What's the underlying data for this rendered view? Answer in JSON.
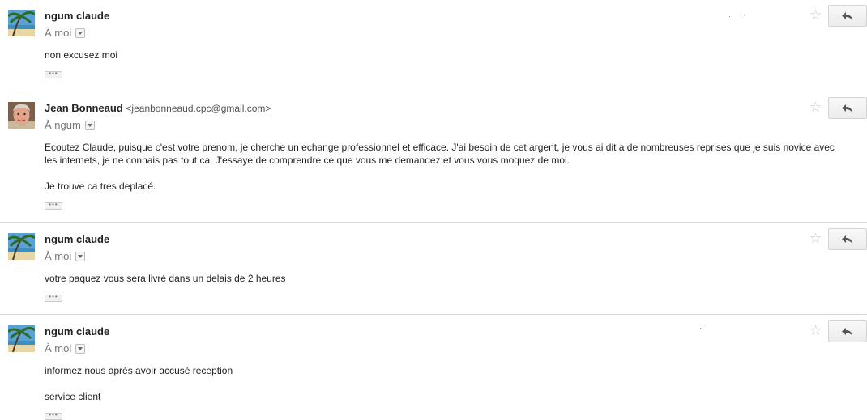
{
  "messages": [
    {
      "sender": "ngum claude",
      "sender_email": "",
      "recipient": "À moi",
      "paragraphs": [
        "non excusez moi"
      ],
      "avatar": "beach-palm-avatar"
    },
    {
      "sender": "Jean Bonneaud",
      "sender_email": "<jeanbonneaud.cpc@gmail.com>",
      "recipient": "À ngum",
      "paragraphs": [
        "Ecoutez Claude, puisque c'est votre prenom, je cherche un echange professionnel et efficace. J'ai besoin de cet argent, je vous ai dit a de nombreuses reprises que je suis novice avec les internets, je ne connais pas tout ca. J'essaye de comprendre ce que vous me demandez et vous vous moquez de moi.",
        "Je trouve ca tres deplacé."
      ],
      "avatar": "person-photo-avatar"
    },
    {
      "sender": "ngum claude",
      "sender_email": "",
      "recipient": "À moi",
      "paragraphs": [
        "votre paquez vous sera livré dans un delais de 2 heures"
      ],
      "avatar": "beach-palm-avatar"
    },
    {
      "sender": "ngum claude",
      "sender_email": "",
      "recipient": "À moi",
      "paragraphs": [
        "informez nous après avoir accusé reception",
        "service client"
      ],
      "avatar": "beach-palm-avatar"
    }
  ],
  "icons": {
    "star": "star-icon",
    "reply": "reply-arrow-icon",
    "dropdown": "chevron-down-icon",
    "ellipsis": "show-trimmed-content-icon"
  },
  "colors": {
    "star": "#c8c8c8",
    "separator": "#d8d8d8",
    "recipient_text": "#777777"
  }
}
